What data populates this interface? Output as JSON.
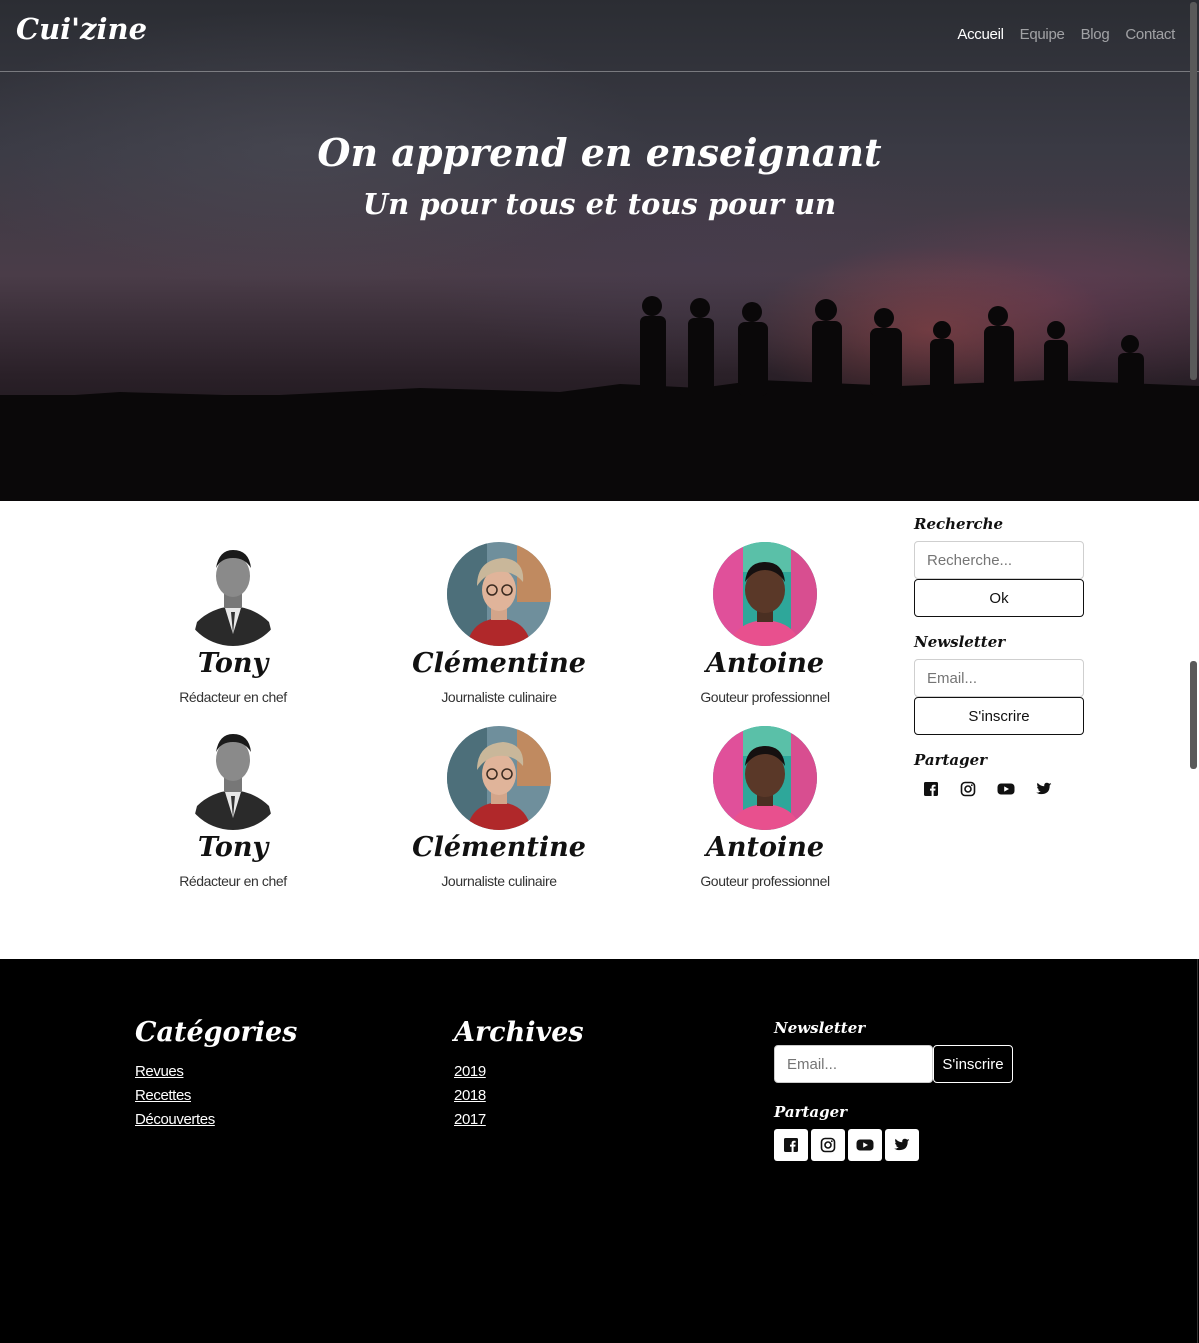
{
  "navbar": {
    "brand": "Cui'zine",
    "links": [
      {
        "label": "Accueil",
        "active": true
      },
      {
        "label": "Equipe",
        "active": false
      },
      {
        "label": "Blog",
        "active": false
      },
      {
        "label": "Contact",
        "active": false
      }
    ]
  },
  "hero": {
    "title": "On apprend en enseignant",
    "subtitle": "Un pour tous et tous pour un"
  },
  "team": {
    "members": [
      {
        "name": "Tony",
        "role": "Rédacteur en chef"
      },
      {
        "name": "Clémentine",
        "role": "Journaliste culinaire"
      },
      {
        "name": "Antoine",
        "role": "Gouteur professionnel"
      },
      {
        "name": "Tony",
        "role": "Rédacteur en chef"
      },
      {
        "name": "Clémentine",
        "role": "Journaliste culinaire"
      },
      {
        "name": "Antoine",
        "role": "Gouteur professionnel"
      }
    ]
  },
  "sidebar": {
    "search_heading": "Recherche",
    "search_placeholder": "Recherche...",
    "search_button": "Ok",
    "newsletter_heading": "Newsletter",
    "newsletter_placeholder": "Email...",
    "newsletter_button": "S'inscrire",
    "share_heading": "Partager",
    "share_icons": [
      "facebook-icon",
      "instagram-icon",
      "youtube-icon",
      "twitter-icon"
    ]
  },
  "footer": {
    "categories_title": "Catégories",
    "categories": [
      "Revues",
      "Recettes",
      "Découvertes"
    ],
    "archives_title": "Archives",
    "archives": [
      "2019",
      "2018",
      "2017"
    ],
    "newsletter_heading": "Newsletter",
    "newsletter_placeholder": "Email...",
    "newsletter_button": "S'inscrire",
    "share_heading": "Partager"
  },
  "colors": {
    "footer_bg": "#000000",
    "text_dark": "#111111"
  }
}
